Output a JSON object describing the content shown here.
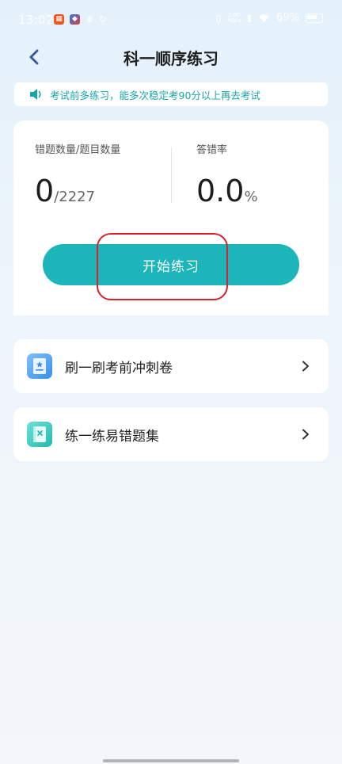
{
  "status_bar": {
    "time": "13:02",
    "net_speed_value": "2.00",
    "net_speed_unit": "MB/s",
    "battery": "69%"
  },
  "nav": {
    "title": "科一顺序练习"
  },
  "notice": {
    "text": "考试前多练习，能多次稳定考90分以上再去考试"
  },
  "stats": {
    "errors_label": "错题数量/题目数量",
    "errors_count": "0",
    "total_questions": "/2227",
    "error_rate_label": "答错率",
    "error_rate_value": "0.0",
    "error_rate_unit": "%"
  },
  "start_button": {
    "label": "开始练习"
  },
  "menu": [
    {
      "label": "刷一刷考前冲刺卷",
      "icon": "exam-paper-icon"
    },
    {
      "label": "练一练易错题集",
      "icon": "error-book-icon"
    }
  ],
  "colors": {
    "accent": "#1cb5b9",
    "highlight": "#d6222b",
    "notice_text": "#1aa7a9"
  }
}
